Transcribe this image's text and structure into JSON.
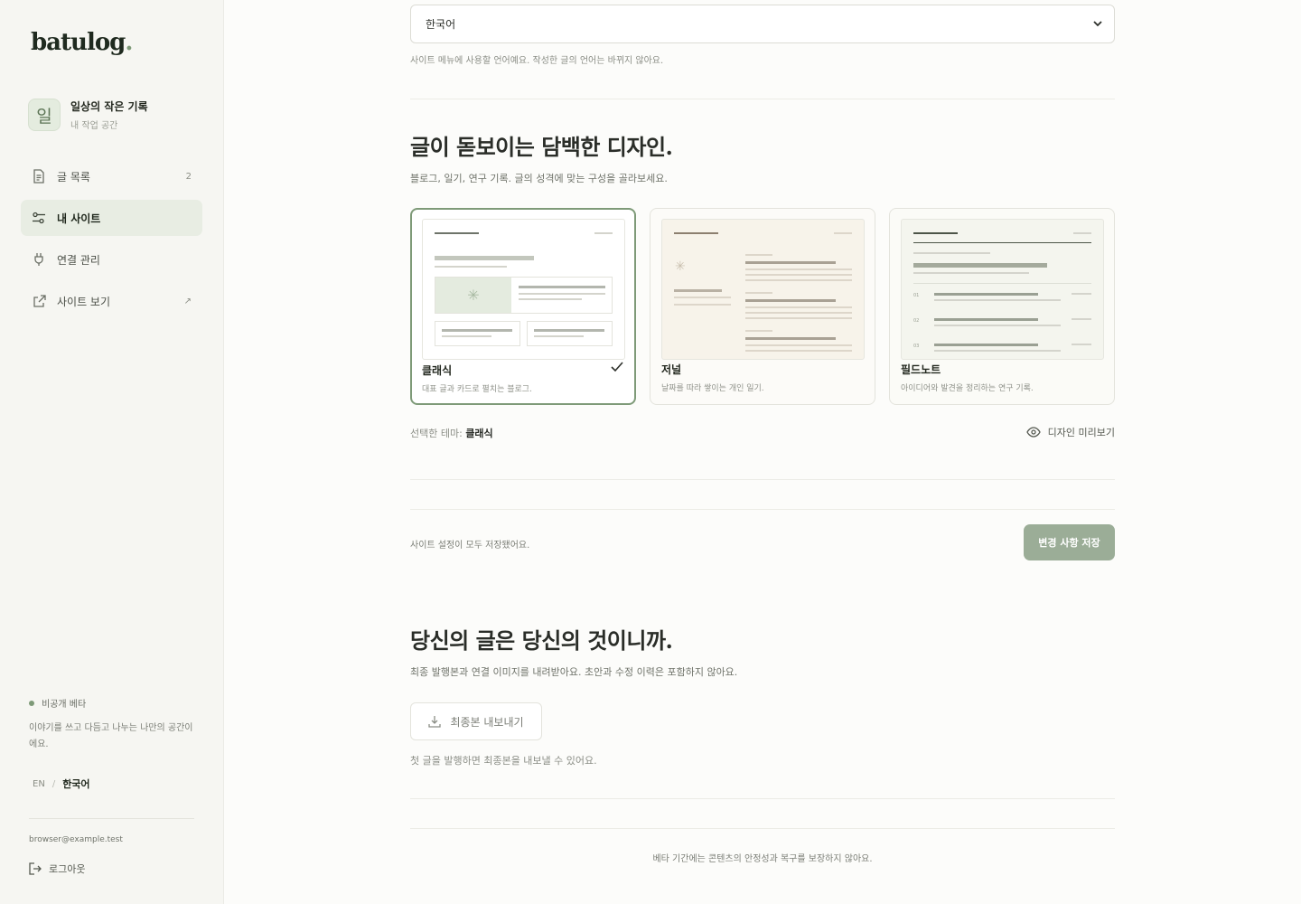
{
  "sidebar": {
    "logo": "batulog",
    "logo_dot": ".",
    "workspace": {
      "avatar": "일",
      "name": "일상의 작은 기록",
      "subtitle": "내 작업 공간"
    },
    "nav": [
      {
        "label": "글 목록",
        "badge": "2",
        "icon": "document-icon"
      },
      {
        "label": "내 사이트",
        "icon": "sliders-icon",
        "active": true
      },
      {
        "label": "연결 관리",
        "icon": "plug-icon"
      },
      {
        "label": "사이트 보기",
        "icon": "external-link-icon",
        "trailing": "↗"
      }
    ],
    "beta_label": "비공개 베타",
    "beta_desc": "이야기를 쓰고 다듬고 나누는 나만의 공간이에요.",
    "lang_en": "EN",
    "lang_sep": "/",
    "lang_current": "한국어",
    "email": "browser@example.test",
    "logout": "로그아웃"
  },
  "main": {
    "language_select": {
      "value": "한국어"
    },
    "language_help": "사이트 메뉴에 사용할 언어예요. 작성한 글의 언어는 바뀌지 않아요.",
    "design": {
      "title": "글이 돋보이는 담백한 디자인.",
      "desc": "블로그, 일기, 연구 기록. 글의 성격에 맞는 구성을 골라보세요.",
      "themes": [
        {
          "name": "클래식",
          "desc": "대표 글과 카드로 펼치는 블로그.",
          "selected": true
        },
        {
          "name": "저널",
          "desc": "날짜를 따라 쌓이는 개인 일기."
        },
        {
          "name": "필드노트",
          "desc": "아이디어와 발견을 정리하는 연구 기록.",
          "numbers": [
            "01",
            "02",
            "03"
          ]
        }
      ],
      "selected_label": "선택한 테마:",
      "selected_value": "클래식",
      "preview_button": "디자인 미리보기"
    },
    "save": {
      "message": "사이트 설정이 모두 저장됐어요.",
      "button": "변경 사항 저장"
    },
    "export": {
      "title": "당신의 글은 당신의 것이니까.",
      "desc": "최종 발행본과 연결 이미지를 내려받아요. 초안과 수정 이력은 포함하지 않아요.",
      "button": "최종본 내보내기",
      "note": "첫 글을 발행하면 최종본을 내보낼 수 있어요."
    },
    "footer": "베타 기간에는 콘텐츠의 안정성과 복구를 보장하지 않아요."
  },
  "colors": {
    "accent": "#7e9a78",
    "save_button": "#9bad97",
    "active_nav": "#e8ede3"
  }
}
